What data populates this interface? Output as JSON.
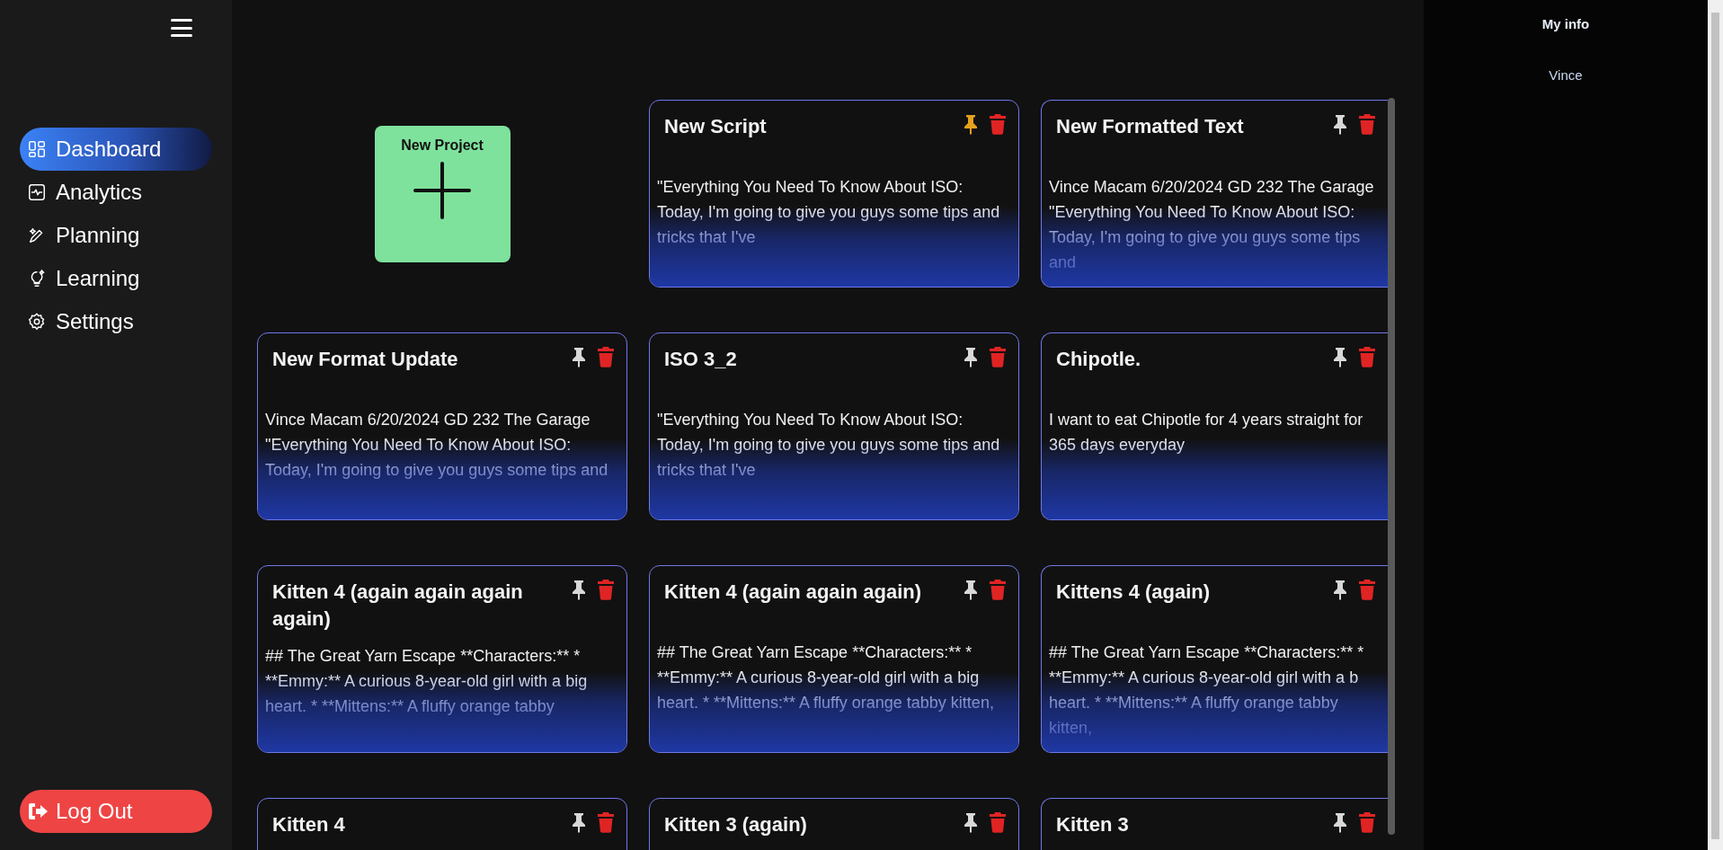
{
  "sidebar": {
    "items": [
      {
        "label": "Dashboard",
        "selected": true
      },
      {
        "label": "Analytics",
        "selected": false
      },
      {
        "label": "Planning",
        "selected": false
      },
      {
        "label": "Learning",
        "selected": false
      },
      {
        "label": "Settings",
        "selected": false
      }
    ],
    "logout_button": "Log Out"
  },
  "new_project": {
    "label": "New Project"
  },
  "cards": [
    {
      "title": "New Script",
      "pinned": true,
      "body": "\"Everything You Need To Know About ISO: Today, I'm going to give you guys some tips and tricks that I've"
    },
    {
      "title": "New Formatted Text",
      "pinned": false,
      "body": "Vince Macam 6/20/2024 GD 232 The Garage \"Everything You Need To Know About ISO: Today, I'm going to give you guys some tips and"
    },
    {
      "title": "New Format Update",
      "pinned": false,
      "body": "Vince Macam 6/20/2024 GD 232 The Garage \"Everything You Need To Know About ISO: Today, I'm going to give you guys some tips and"
    },
    {
      "title": "ISO 3_2",
      "pinned": false,
      "body": "\"Everything You Need To Know About ISO: Today, I'm going to give you guys some tips and tricks that I've"
    },
    {
      "title": "Chipotle.",
      "pinned": false,
      "body": "I want to eat Chipotle for 4 years straight for 365 days everyday"
    },
    {
      "title": "Kitten 4 (again again again again)",
      "pinned": false,
      "body": "## The Great Yarn Escape **Characters:** * **Emmy:** A curious 8-year-old girl with a big heart. * **Mittens:** A fluffy orange tabby"
    },
    {
      "title": "Kitten 4 (again again again)",
      "pinned": false,
      "body": "## The Great Yarn Escape **Characters:** * **Emmy:** A curious 8-year-old girl with a big heart. * **Mittens:** A fluffy orange tabby kitten,"
    },
    {
      "title": "Kittens 4 (again)",
      "pinned": false,
      "body": "## The Great Yarn Escape **Characters:** * **Emmy:** A curious 8-year-old girl with a b heart. * **Mittens:** A fluffy orange tabby kitten,"
    },
    {
      "title": "Kitten 4",
      "pinned": false
    },
    {
      "title": "Kitten 3 (again)",
      "pinned": false
    },
    {
      "title": "Kitten 3",
      "pinned": false
    }
  ],
  "my_info": {
    "title": "My info",
    "name": "Vince"
  }
}
